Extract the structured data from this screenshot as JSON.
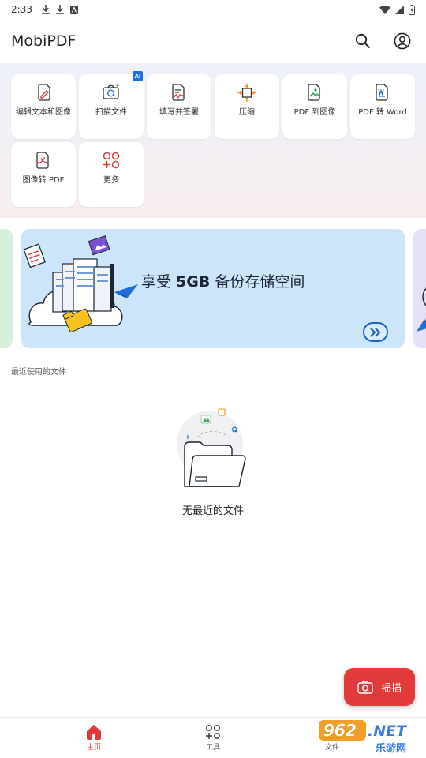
{
  "status_bar": {
    "time": "2:33"
  },
  "app_bar": {
    "title": "MobiPDF"
  },
  "tools": [
    {
      "label": "编辑文本和图像",
      "icon": "edit-pen-icon"
    },
    {
      "label": "扫描文件",
      "icon": "camera-scan-icon",
      "badge": "AI"
    },
    {
      "label": "填写并签署",
      "icon": "sign-document-icon"
    },
    {
      "label": "压缩",
      "icon": "compress-icon"
    },
    {
      "label": "PDF 到图像",
      "icon": "pdf-to-image-icon"
    },
    {
      "label": "PDF 转 Word",
      "icon": "pdf-to-word-icon"
    },
    {
      "label": "图像转 PDF",
      "icon": "image-to-pdf-icon"
    },
    {
      "label": "更多",
      "icon": "more-tools-icon"
    }
  ],
  "banner": {
    "prefix": "享受 ",
    "highlight": "5GB",
    "suffix": " 备份存储空间"
  },
  "recent": {
    "label": "最近使用的文件",
    "empty_text": "无最近的文件"
  },
  "fab": {
    "label": "掃描"
  },
  "bottom_nav": [
    {
      "label": "主页",
      "icon": "home-icon",
      "active": true
    },
    {
      "label": "工具",
      "icon": "tools-grid-icon",
      "active": false
    },
    {
      "label": "文件",
      "icon": "folder-icon",
      "active": false
    }
  ],
  "watermark": {
    "text1": "962",
    "text2": ".NET",
    "text3": "乐游网"
  },
  "colors": {
    "accent": "#e2393a",
    "banner_bg": "#cce5fb",
    "link_blue": "#1f63c4"
  }
}
